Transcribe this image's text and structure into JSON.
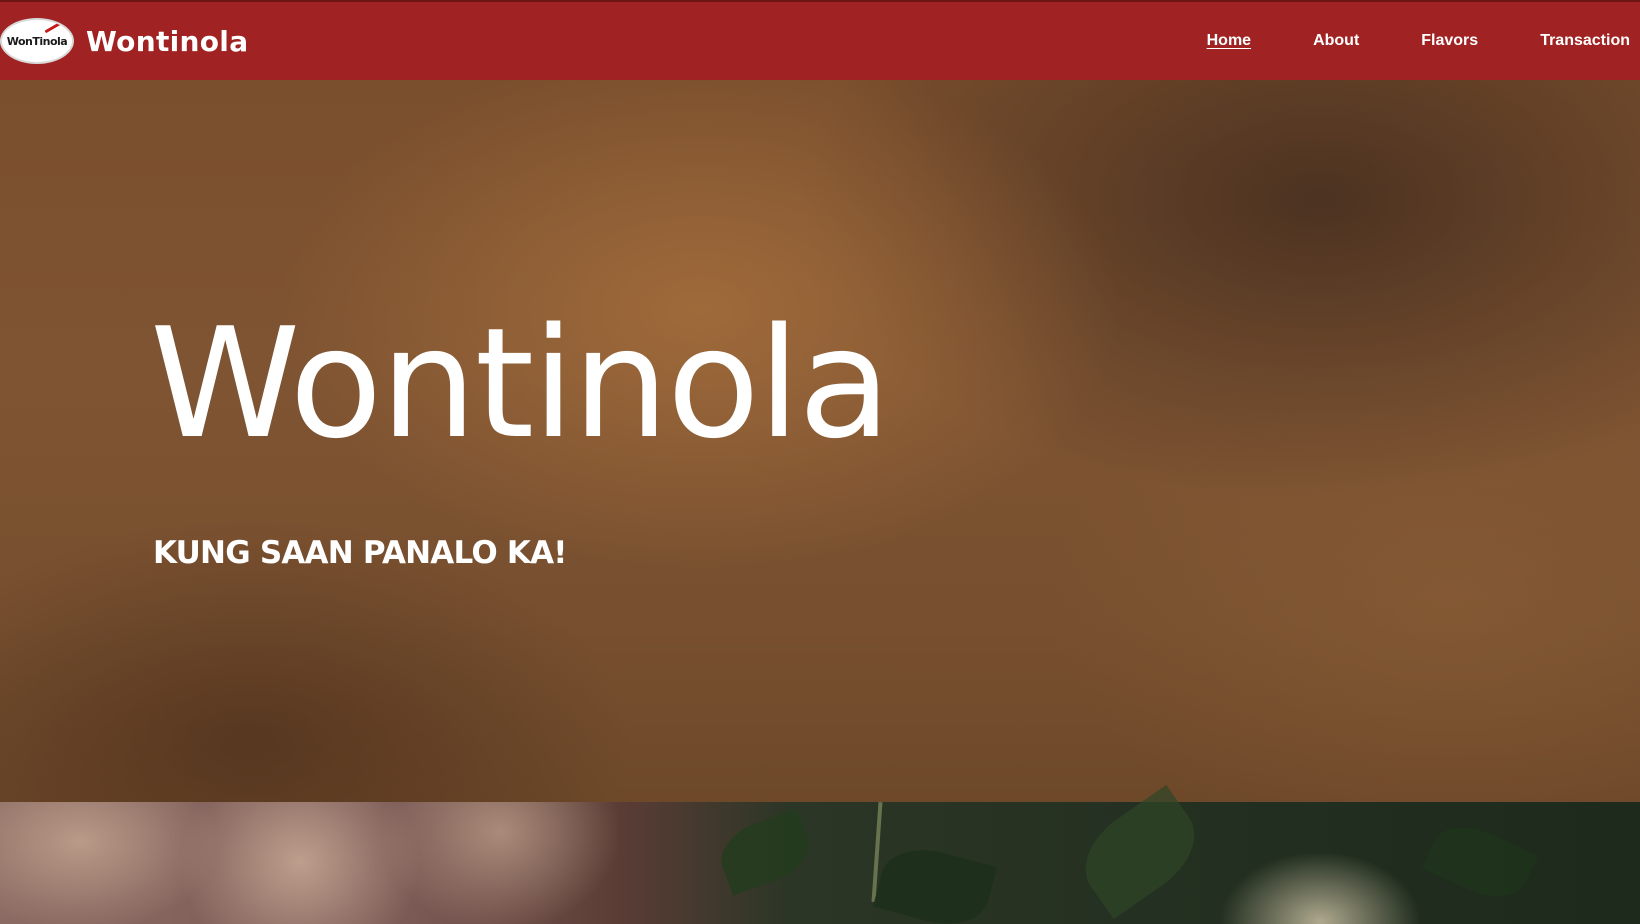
{
  "navbar": {
    "logo_text": "WonTinola",
    "brand": "Wontinola",
    "links": [
      {
        "label": "Home",
        "active": true
      },
      {
        "label": "About",
        "active": false
      },
      {
        "label": "Flavors",
        "active": false
      },
      {
        "label": "Transaction",
        "active": false
      }
    ]
  },
  "hero": {
    "title": "Wontinola",
    "tagline": "KUNG SAAN PANALO KA!"
  },
  "colors": {
    "navbar_bg": "#a02222",
    "text": "#ffffff",
    "hero_bg": "#7a4f2d"
  }
}
